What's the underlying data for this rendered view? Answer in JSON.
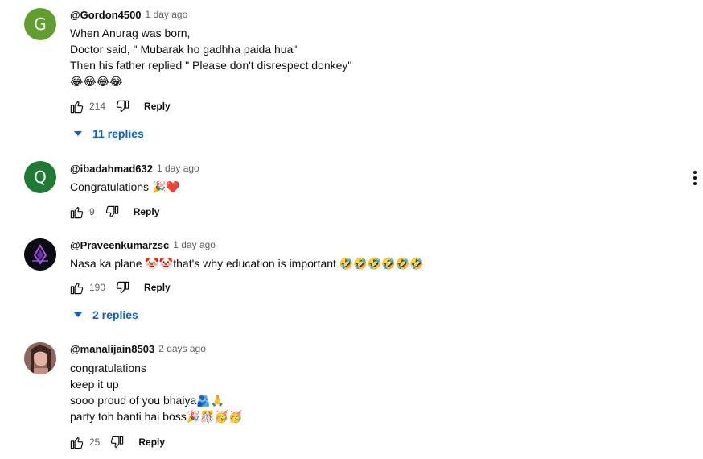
{
  "comments": [
    {
      "author": "@Gordon4500",
      "time": "1 day ago",
      "avatar_letter": "G",
      "avatar_color": "#5f9e2f",
      "lines": [
        "When Anurag was born,",
        "Doctor said, \" Mubarak ho gadhha paida hua\"",
        "Then his father replied \" Please don't disrespect donkey\"",
        "😂😂😂😂"
      ],
      "likes": "214",
      "reply_label": "Reply",
      "replies_label": "11 replies"
    },
    {
      "author": "@ibadahmad632",
      "time": "1 day ago",
      "avatar_letter": "Q",
      "avatar_color": "#1f7a33",
      "lines": [
        "Congratulations 🎉❤️"
      ],
      "likes": "9",
      "reply_label": "Reply"
    },
    {
      "author": "@Praveenkumarzsc",
      "time": "1 day ago",
      "avatar_letter": "",
      "avatar_color": "#0b0b14",
      "lines": [
        "Nasa ka plane 🤡🤡that's why education is important 🤣🤣🤣🤣🤣🤣"
      ],
      "likes": "190",
      "reply_label": "Reply",
      "replies_label": "2 replies"
    },
    {
      "author": "@manalijain8503",
      "time": "2 days ago",
      "avatar_letter": "",
      "avatar_color": "#a97f72",
      "lines": [
        "congratulations",
        "keep it up",
        "sooo proud of you bhaiya🫂🙏",
        "party toh banti hai boss🎉🎊🥳🥳"
      ],
      "likes": "25",
      "reply_label": "Reply"
    }
  ],
  "accent_color": "#065fd4"
}
